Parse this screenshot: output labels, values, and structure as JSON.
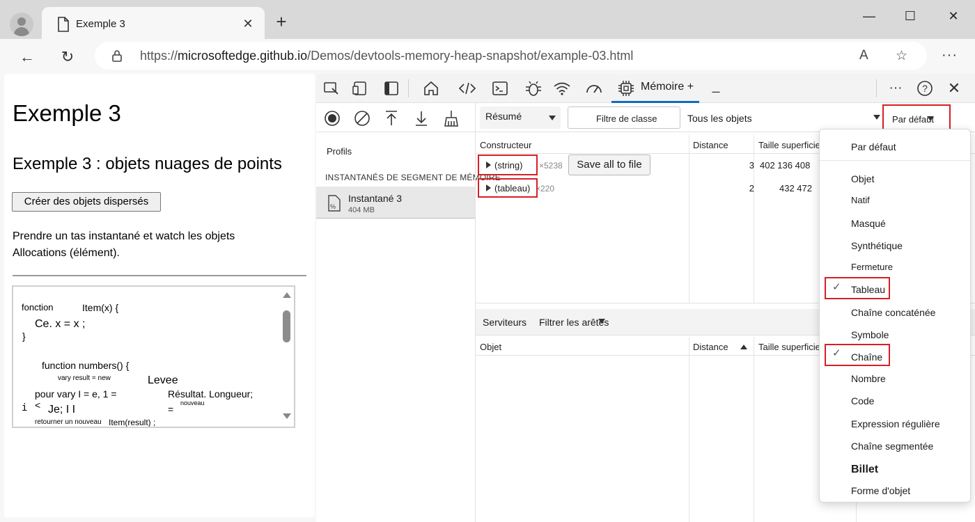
{
  "browser": {
    "tab_title": "Exemple 3",
    "url_prefix": "https://",
    "url_host": "microsoftedge.github.io",
    "url_path": "/Demos/devtools-memory-heap-snapshot/example-03.html",
    "window_minimize": "—",
    "window_maximize": "☐",
    "window_close": "✕",
    "new_tab": "+",
    "tab_close": "✕",
    "back": "←",
    "refresh": "↻",
    "read_aloud": "A",
    "favorite": "☆",
    "more": "···"
  },
  "page": {
    "heading": "Exemple 3",
    "subheading": "Exemple 3 : objets nuages de points",
    "button": "Créer des objets dispersés",
    "para_line1": "Prendre un tas instantané et watch les objets",
    "para_line2": "Allocations (élément).",
    "code": {
      "l1a": "fonction",
      "l1b": "Item(x) {",
      "l2": "Ce. x = x ;",
      "l3": "}",
      "l4": "function numbers() {",
      "l5": "vary result = new",
      "l5b": "Levee",
      "l6a": "pour vary I = e, 1 =",
      "l6b": "Résultat. Longueur;",
      "l7a": "i",
      "l7b": "<",
      "l7c": "Je; I I",
      "l7d": "=",
      "l7e": "nouveau",
      "l8a": "retourner un nouveau",
      "l8b": "Item(result) ;"
    }
  },
  "devtools": {
    "memory_tab": "Mémoire",
    "memory_tab_plus": "+",
    "more": "···",
    "help": "?",
    "close": "✕",
    "profiles_label": "Profils",
    "snapshots_header": "INSTANTANÉS DE SEGMENT DE MÉMOIRE",
    "snapshot": {
      "name": "Instantané 3",
      "size": "404 MB"
    },
    "view_select": "Résumé",
    "class_filter": "Filtre de classe",
    "objects_select": "Tous les objets",
    "default_select": "Par défaut",
    "columns": {
      "constructor": "Constructeur",
      "distance": "Distance",
      "shallow": "Taille superficielle"
    },
    "rows": [
      {
        "name": "(string)",
        "count": "×5238",
        "distance": "3",
        "shallow": "402 136 408"
      },
      {
        "name": "(tableau)",
        "count": "×220",
        "distance": "2",
        "shallow": "432 472"
      }
    ],
    "tooltip": "Save all to file",
    "retainers": "Serviteurs",
    "filter_edges": "Filtrer les arêtes",
    "ret_columns": {
      "object": "Objet",
      "distance": "Distance",
      "shallow": "Taille superficielle"
    },
    "dropdown": [
      "Par défaut",
      "Objet",
      "Natif",
      "Masqué",
      "Synthétique",
      "Fermeture",
      "Tableau",
      "Chaîne concaténée",
      "Symbole",
      "Chaîne",
      "Nombre",
      "Code",
      "Expression régulière",
      "Chaîne segmentée",
      "Billet",
      "Forme d'objet"
    ],
    "check_mark": "✓"
  },
  "colors": {
    "accent": "#0f6cbd",
    "highlight": "#d61f26"
  }
}
